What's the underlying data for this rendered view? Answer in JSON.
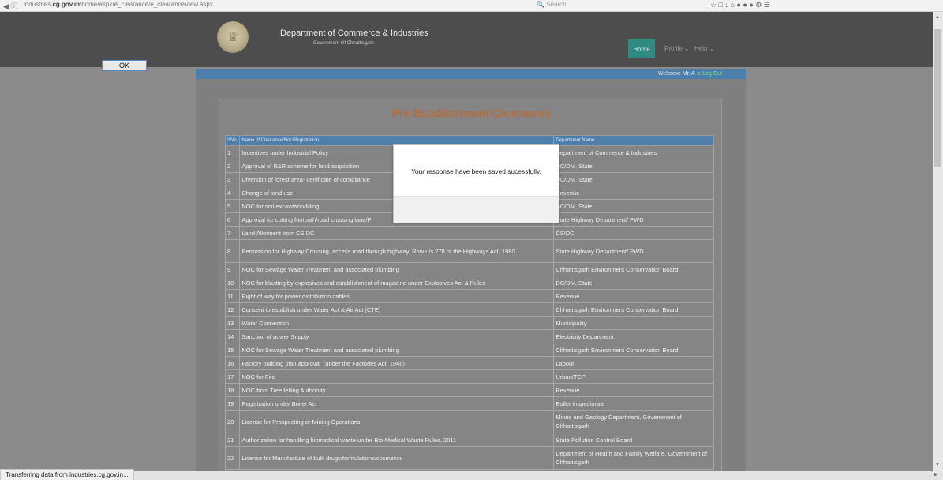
{
  "browser": {
    "url_prefix": "industries.",
    "url_domain": "cg.gov.in",
    "url_rest": "/home/aspx/e_clearance/e_clearanceView.aspx",
    "search_placeholder": "Search",
    "status_text": "Transferring data from industries.cg.gov.in..."
  },
  "header": {
    "title": "Department of Commerce & Industries",
    "subtitle": "Government Of Chhattisgarh",
    "nav": {
      "home": "Home",
      "profile": "Profile",
      "help": "Help"
    }
  },
  "welcome": {
    "text": "Welcome Mr. A",
    "logout": "Log Out"
  },
  "page": {
    "title": "Pre-Establishment Clearances"
  },
  "table": {
    "headers": [
      "SNo.",
      "Name of Clearance/Noc/Registration",
      "Department Name"
    ],
    "rows": [
      {
        "sn": "1",
        "name": "Incentives under Industrial Policy",
        "dept": "Department of Commerce & Industries"
      },
      {
        "sn": "2",
        "name": "Approval of R&R scheme for land acquisition",
        "dept": "DC/DM, State"
      },
      {
        "sn": "3",
        "name": "Diversion of forest area- certificate of compliance",
        "dept": "DC/DM, State"
      },
      {
        "sn": "4",
        "name": "Change of land use",
        "dept": "Revenue"
      },
      {
        "sn": "5",
        "name": "NOC for soil excavation/filling",
        "dept": "DC/DM, State"
      },
      {
        "sn": "6",
        "name": "Approval for cutting footpath/road crossing lane/P",
        "dept": "State Highway Department/ PWD"
      },
      {
        "sn": "7",
        "name": "Land Allotment from CSIDC",
        "dept": "CSIDC"
      },
      {
        "sn": "8",
        "name": "Permission for Highway Crossing, access road through highway, Row u/s 278 of the Highways Act, 1980",
        "dept": "State Highway Department/ PWD"
      },
      {
        "sn": "9",
        "name": "NOC for Sewage Water Treatment and associated plumbing",
        "dept": "Chhattisgarh Environment Conservation Board"
      },
      {
        "sn": "10",
        "name": "NOC for blasting by explosives and establishment of magazine under Explosives Act & Rules",
        "dept": "DC/DM, State"
      },
      {
        "sn": "11",
        "name": "Right of way for power distribution cables",
        "dept": "Revenue"
      },
      {
        "sn": "12",
        "name": "Consent to establish under Water Act & Air Act (CTE)",
        "dept": "Chhattisgarh Environment Conservation Board"
      },
      {
        "sn": "13",
        "name": "Water Connection",
        "dept": "Municipality"
      },
      {
        "sn": "14",
        "name": "Sanction of power Supply",
        "dept": "Electricity Department"
      },
      {
        "sn": "15",
        "name": "NOC for Sewage Water Treatment and associated plumbing",
        "dept": "Chhattisgarh Environment Conservation Board"
      },
      {
        "sn": "16",
        "name": "Factory building plan approval' (under the Factories Act, 1948)",
        "dept": "Labour"
      },
      {
        "sn": "17",
        "name": "NOC for Fire",
        "dept": "Urban/TCP"
      },
      {
        "sn": "18",
        "name": "NOC from Tree felling Authoruty",
        "dept": "Revenue"
      },
      {
        "sn": "19",
        "name": "Registration under Boiler Act",
        "dept": "Boiler inspectorate"
      },
      {
        "sn": "20",
        "name": "License for Prospecting or Mining Operations",
        "dept": "Mines and Geology Department, Government of Chhattisgarh"
      },
      {
        "sn": "21",
        "name": "Authorization for handling biomedical waste under Bio-Medical Waste Rules, 2011",
        "dept": "State Pollution Control Board"
      },
      {
        "sn": "22",
        "name": "License for Manufacture of bulk drugs/formulations/cosmetics",
        "dept": "Department of Health and Family Welfare, Government of Chhattisgarh"
      }
    ]
  },
  "dialog": {
    "message": "Your response have been saved sucessfully.",
    "ok": "OK"
  }
}
